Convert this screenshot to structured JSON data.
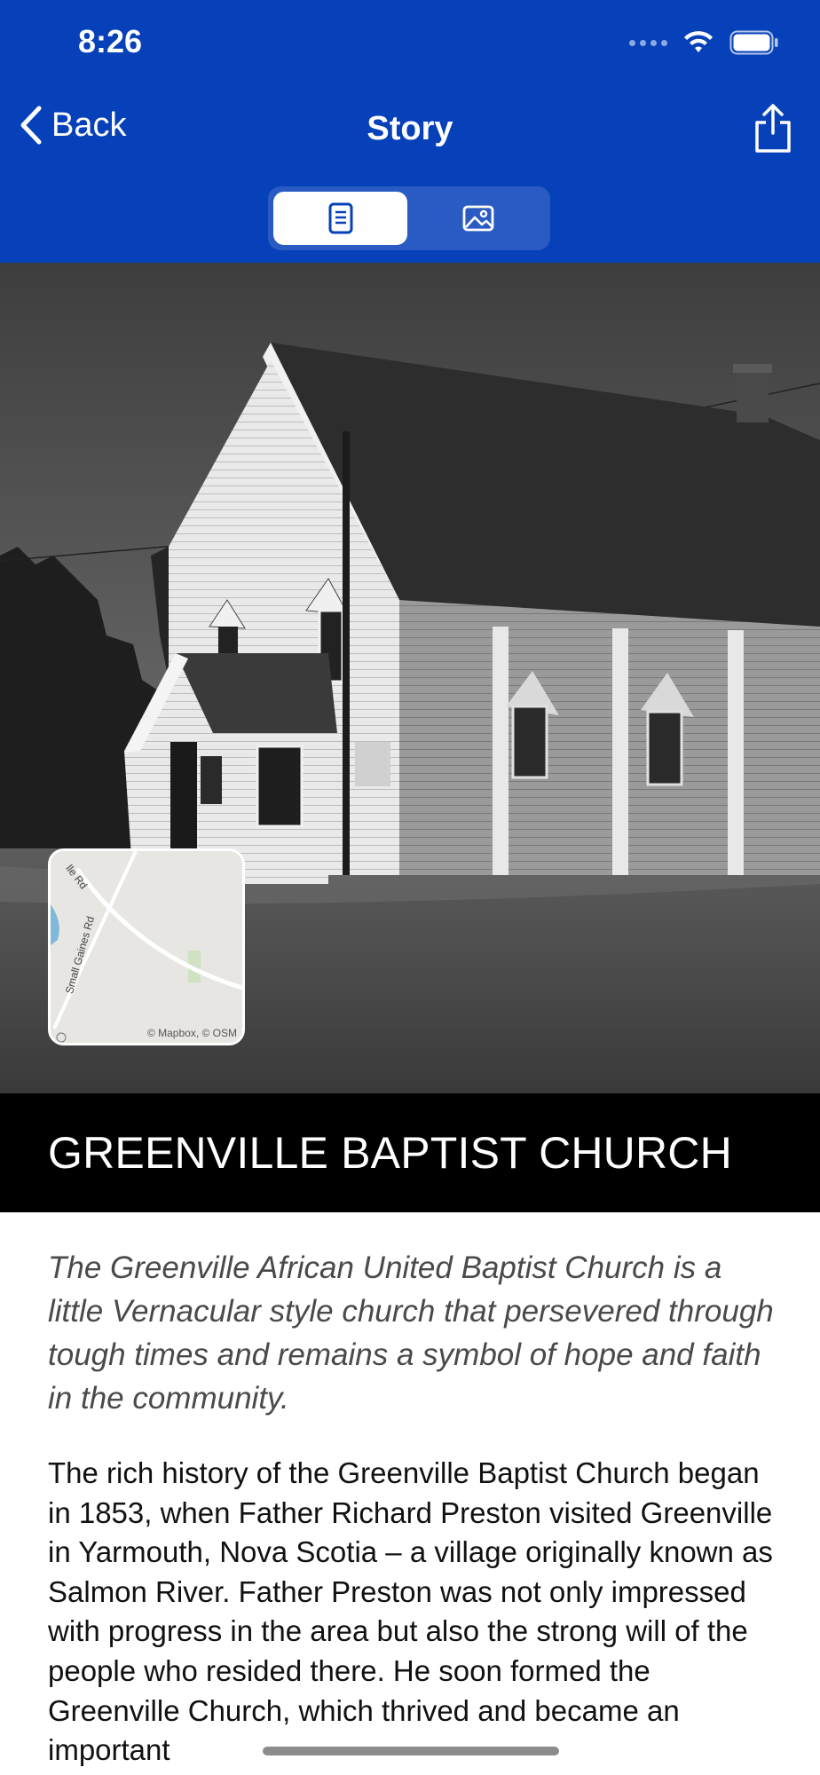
{
  "status_bar": {
    "time": "8:26"
  },
  "nav": {
    "back_label": "Back",
    "title": "Story"
  },
  "segments": [
    {
      "name": "text",
      "icon": "document-icon",
      "selected": true
    },
    {
      "name": "images",
      "icon": "photo-icon",
      "selected": false
    }
  ],
  "map": {
    "attribution": "© Mapbox, © OSM",
    "road_1": "lle Rd",
    "road_2": "Small Gaines Rd"
  },
  "story": {
    "title": "GREENVILLE BAPTIST CHURCH",
    "lede": "The Greenville African United Baptist Church is a little Vernacular style church that persevered through tough times and remains a symbol of hope and faith in the community.",
    "body": "The rich history of the Greenville Baptist Church began in 1853, when Father Richard Preston visited Greenville in Yarmouth, Nova Scotia – a village originally known as Salmon River. Father Preston was not only impressed with progress in the area but also the strong will of the people who resided there. He soon formed the Greenville Church, which thrived and became an important"
  },
  "colors": {
    "header": "#0641b9",
    "title_band": "#000000",
    "lede": "#4a4a4a"
  }
}
